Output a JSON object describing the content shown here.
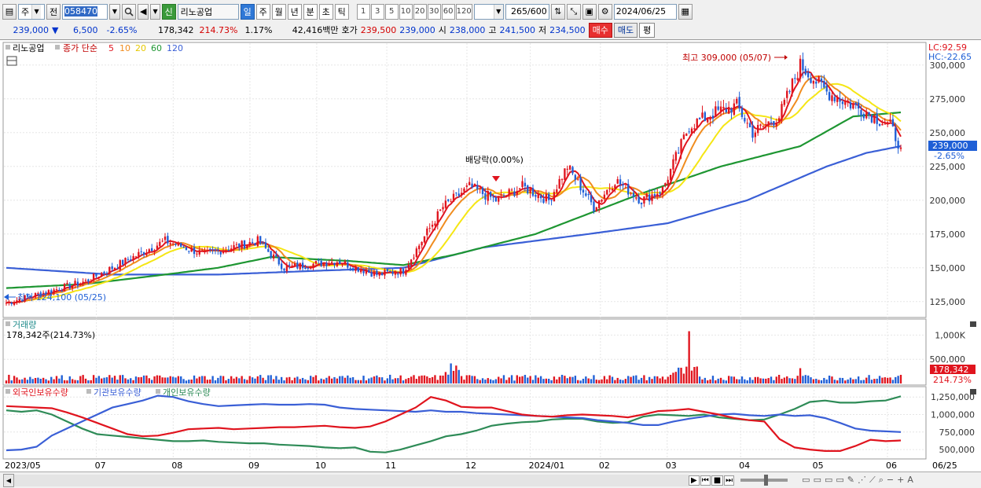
{
  "toolbar": {
    "market_select": "주",
    "prev_label": "전",
    "stock_code": "058470",
    "credit_badge": "신",
    "stock_name": "리노공업",
    "periods": [
      "일",
      "주",
      "월",
      "년",
      "분",
      "초",
      "틱"
    ],
    "active_period": "일",
    "numbers": [
      "1",
      "3",
      "5",
      "10",
      "20",
      "30",
      "60",
      "120"
    ],
    "count": "265",
    "count_total": "/600",
    "date": "2024/06/25"
  },
  "quote": {
    "price": "239,000",
    "change_arrow": "▼",
    "change": "6,500",
    "change_pct": "-2.65%",
    "volume": "178,342",
    "volume_ratio": "214.73%",
    "turnover_pct": "1.17%",
    "amount": "42,416백만",
    "bid_label": "호가",
    "bid": "239,500",
    "ask": "239,000",
    "open_label": "시",
    "open": "238,000",
    "high_label": "고",
    "high": "241,500",
    "low_label": "저",
    "low": "234,500",
    "buy_button": "매수",
    "sell_button": "매도",
    "avg_button": "평"
  },
  "colors": {
    "up": "#e0141e",
    "down": "#1f5fd6",
    "ma5": "#e0141e",
    "ma10": "#f08c1e",
    "ma20": "#f5e614",
    "ma60": "#1e9632",
    "ma120": "#3a5fd6",
    "foreign": "#e0141e",
    "institution": "#3a5fd6",
    "individual": "#2e8b57"
  },
  "price_panel": {
    "stock_label": "리노공업",
    "legend_prefix": "종가 단순",
    "ma_labels": [
      "5",
      "10",
      "20",
      "60",
      "120"
    ],
    "lc": "LC:92.59",
    "hc": "HC:-22.65",
    "high_note": "최고 309,000 (05/07)",
    "low_note": "최저 124,100 (05/25)",
    "dividend_note": "배당락(0.00%)",
    "current_price_tag": "239,000",
    "current_pct_tag": "-2.65%",
    "y_ticks": [
      "300,000",
      "275,000",
      "250,000",
      "225,000",
      "200,000",
      "175,000",
      "150,000",
      "125,000"
    ]
  },
  "volume_panel": {
    "title": "거래량",
    "value": "178,342주(214.73%)",
    "y_ticks": [
      "1,000K",
      "500,000"
    ],
    "current_tag": "178,342",
    "current_pct": "214.73%"
  },
  "holdings_panel": {
    "series": [
      "외국인보유수량",
      "기관보유수량",
      "개인보유수량"
    ],
    "y_ticks": [
      "1,250,000",
      "1,000,000",
      "750,000",
      "500,000"
    ]
  },
  "x_axis": [
    "2023/05",
    "07",
    "08",
    "09",
    "10",
    "11",
    "12",
    "2024/01",
    "02",
    "03",
    "04",
    "05",
    "06"
  ],
  "x_axis_right": "06/25",
  "chart_data": {
    "type": "candlestick",
    "x_range": [
      "2023/05",
      "2024/06/25"
    ],
    "price_ylim": [
      115000,
      315000
    ],
    "anchors": [
      {
        "x": 0,
        "close": 124100
      },
      {
        "x": 30,
        "close": 140000
      },
      {
        "x": 60,
        "close": 170000
      },
      {
        "x": 75,
        "close": 160000
      },
      {
        "x": 95,
        "close": 170000
      },
      {
        "x": 105,
        "close": 150000
      },
      {
        "x": 125,
        "close": 155000
      },
      {
        "x": 140,
        "close": 145000
      },
      {
        "x": 150,
        "close": 148000
      },
      {
        "x": 165,
        "close": 195000
      },
      {
        "x": 175,
        "close": 210000
      },
      {
        "x": 185,
        "close": 200000
      },
      {
        "x": 195,
        "close": 210000
      },
      {
        "x": 205,
        "close": 200000
      },
      {
        "x": 212,
        "close": 225000
      },
      {
        "x": 222,
        "close": 195000
      },
      {
        "x": 230,
        "close": 215000
      },
      {
        "x": 240,
        "close": 200000
      },
      {
        "x": 248,
        "close": 208000
      },
      {
        "x": 258,
        "close": 255000
      },
      {
        "x": 268,
        "close": 265000
      },
      {
        "x": 276,
        "close": 270000
      },
      {
        "x": 282,
        "close": 250000
      },
      {
        "x": 292,
        "close": 262000
      },
      {
        "x": 300,
        "close": 300000
      },
      {
        "x": 310,
        "close": 280000
      },
      {
        "x": 325,
        "close": 265000
      },
      {
        "x": 334,
        "close": 255000
      },
      {
        "x": 338,
        "close": 239000
      }
    ],
    "ma60_anchors": [
      [
        0,
        135000
      ],
      [
        30,
        138000
      ],
      [
        60,
        145000
      ],
      [
        80,
        150000
      ],
      [
        100,
        158000
      ],
      [
        130,
        155000
      ],
      [
        150,
        152000
      ],
      [
        170,
        160000
      ],
      [
        200,
        175000
      ],
      [
        240,
        205000
      ],
      [
        270,
        225000
      ],
      [
        300,
        240000
      ],
      [
        320,
        262000
      ],
      [
        338,
        265000
      ]
    ],
    "ma120_anchors": [
      [
        0,
        150000
      ],
      [
        40,
        145000
      ],
      [
        80,
        145000
      ],
      [
        120,
        148000
      ],
      [
        150,
        150000
      ],
      [
        180,
        165000
      ],
      [
        220,
        175000
      ],
      [
        250,
        183000
      ],
      [
        280,
        200000
      ],
      [
        310,
        225000
      ],
      [
        325,
        235000
      ],
      [
        338,
        240000
      ]
    ],
    "holdings": {
      "x_points": 60,
      "foreign": [
        1120000,
        1110000,
        1100000,
        1090000,
        1030000,
        960000,
        880000,
        800000,
        720000,
        690000,
        700000,
        740000,
        790000,
        800000,
        810000,
        790000,
        800000,
        810000,
        820000,
        820000,
        830000,
        840000,
        820000,
        810000,
        830000,
        900000,
        1000000,
        1100000,
        1250000,
        1200000,
        1110000,
        1100000,
        1100000,
        1050000,
        1000000,
        980000,
        970000,
        990000,
        1000000,
        990000,
        980000,
        960000,
        1000000,
        1050000,
        1060000,
        1080000,
        1040000,
        1000000,
        950000,
        920000,
        900000,
        650000,
        530000,
        500000,
        480000,
        480000,
        550000,
        640000,
        620000,
        630000
      ],
      "institution": [
        490000,
        500000,
        540000,
        700000,
        800000,
        900000,
        1000000,
        1100000,
        1150000,
        1200000,
        1270000,
        1250000,
        1190000,
        1150000,
        1120000,
        1130000,
        1140000,
        1150000,
        1140000,
        1140000,
        1150000,
        1140000,
        1100000,
        1080000,
        1070000,
        1060000,
        1050000,
        1040000,
        1060000,
        1040000,
        1040000,
        1020000,
        1010000,
        1000000,
        990000,
        980000,
        970000,
        960000,
        950000,
        920000,
        900000,
        880000,
        850000,
        850000,
        900000,
        940000,
        970000,
        1000000,
        1010000,
        990000,
        980000,
        1000000,
        980000,
        990000,
        950000,
        880000,
        800000,
        770000,
        760000,
        750000
      ],
      "individual": [
        1060000,
        1040000,
        1060000,
        1000000,
        900000,
        800000,
        720000,
        700000,
        680000,
        660000,
        640000,
        620000,
        620000,
        630000,
        610000,
        600000,
        590000,
        590000,
        570000,
        560000,
        550000,
        530000,
        520000,
        530000,
        470000,
        460000,
        500000,
        560000,
        620000,
        690000,
        720000,
        770000,
        840000,
        870000,
        890000,
        900000,
        930000,
        940000,
        940000,
        900000,
        880000,
        890000,
        970000,
        1000000,
        990000,
        980000,
        1000000,
        960000,
        940000,
        920000,
        930000,
        1000000,
        1080000,
        1180000,
        1200000,
        1170000,
        1170000,
        1190000,
        1200000,
        1260000
      ]
    }
  }
}
